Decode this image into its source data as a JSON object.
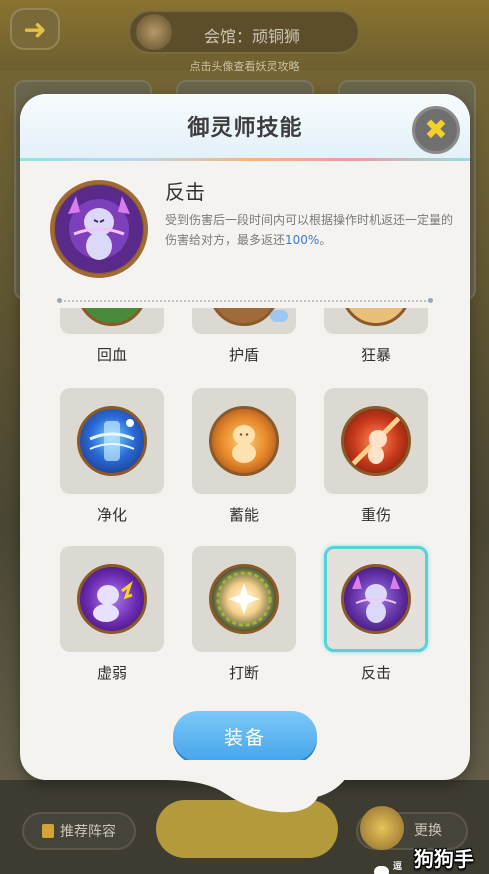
{
  "background": {
    "club_label": "会馆：顽铜狮",
    "hint": "点击头像查看妖灵攻略",
    "recommend_label": "推荐阵容",
    "change_label": "更换"
  },
  "watermark": {
    "small": "逗比",
    "big": "狗狗手游"
  },
  "modal": {
    "title": "御灵师技能",
    "close_icon": "close-x-icon"
  },
  "selected_skill": {
    "name": "反击",
    "desc_before": "受到伤害后一段时间内可以根据操作时机返还一定量的伤害给对方，最多返还",
    "desc_highlight": "100%",
    "desc_after": "。"
  },
  "skills": {
    "row0": [
      {
        "label": "回血",
        "icon": "heal-icon"
      },
      {
        "label": "护盾",
        "icon": "shield-icon"
      },
      {
        "label": "狂暴",
        "icon": "berserk-icon"
      }
    ],
    "row1": [
      {
        "label": "净化",
        "icon": "purify-icon"
      },
      {
        "label": "蓄能",
        "icon": "charge-icon"
      },
      {
        "label": "重伤",
        "icon": "heavy-wound-icon"
      }
    ],
    "row2": [
      {
        "label": "虚弱",
        "icon": "weaken-icon"
      },
      {
        "label": "打断",
        "icon": "interrupt-icon"
      },
      {
        "label": "反击",
        "icon": "counter-icon",
        "selected": true
      }
    ]
  },
  "equip_label": "装备",
  "colors": {
    "accent_blue": "#46a6ea",
    "selected_border": "#55d3d8",
    "close_x": "#f5d02a",
    "highlight_text": "#3a7ad8"
  }
}
